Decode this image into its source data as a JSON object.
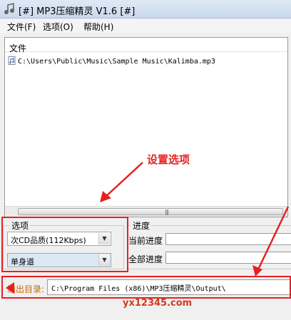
{
  "window": {
    "title": "[#] MP3压缩精灵 V1.6 [#]"
  },
  "menu": {
    "items": [
      "文件(F)",
      "选项(O)",
      "帮助(H)"
    ]
  },
  "file_list": {
    "column_header": "文件",
    "files": [
      "C:\\Users\\Public\\Music\\Sample Music\\Kalimba.mp3"
    ],
    "icon": "audio-file-icon"
  },
  "options": {
    "legend": "选项",
    "quality_value": "次CD品质(112Kbps)",
    "channel_value": "单身道"
  },
  "progress": {
    "legend": "进度",
    "current_label": "当前进度",
    "total_label": "全部进度",
    "current_value": 0,
    "total_value": 0
  },
  "output": {
    "label": "输出目录:",
    "path": "C:\\Program Files (x86)\\MP3压缩精灵\\Output\\"
  },
  "annotation": {
    "text": "设置选项",
    "color": "#e52222"
  },
  "watermark": "yx12345.com"
}
